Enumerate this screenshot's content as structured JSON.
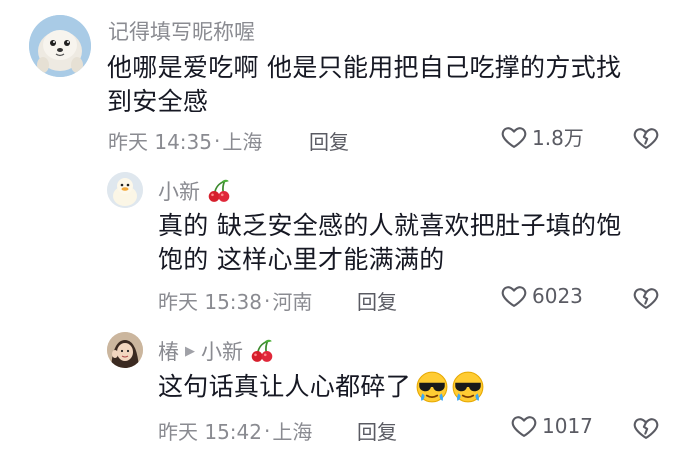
{
  "comments": [
    {
      "username": "记得填写昵称喔",
      "text_line1": "他哪是爱吃啊 他是只能用把自己吃撑的方式找",
      "text_line2": "到安全感",
      "time": "昨天 14:35",
      "location": "上海",
      "reply_label": "回复",
      "likes": "1.8万",
      "avatar_icon": "seal-avatar"
    },
    {
      "username": "小新",
      "username_badge": "cherry-icon",
      "text_line1": "真的 缺乏安全感的人就喜欢把肚子填的饱",
      "text_line2": "饱的 这样心里才能满满的",
      "time": "昨天 15:38",
      "location": "河南",
      "reply_label": "回复",
      "likes": "6023",
      "avatar_icon": "duck-avatar"
    },
    {
      "username": "椿",
      "reply_to": "小新",
      "reply_to_badge": "cherry-icon",
      "text": "这句话真让人心都碎了",
      "text_emojis": [
        "cool-crying-emoji",
        "cool-crying-emoji"
      ],
      "time": "昨天 15:42",
      "location": "上海",
      "reply_label": "回复",
      "likes": "1017",
      "avatar_icon": "girl-avatar"
    }
  ],
  "colors": {
    "text": "#161823",
    "meta": "#8a8b91",
    "action": "#5a5b63"
  }
}
